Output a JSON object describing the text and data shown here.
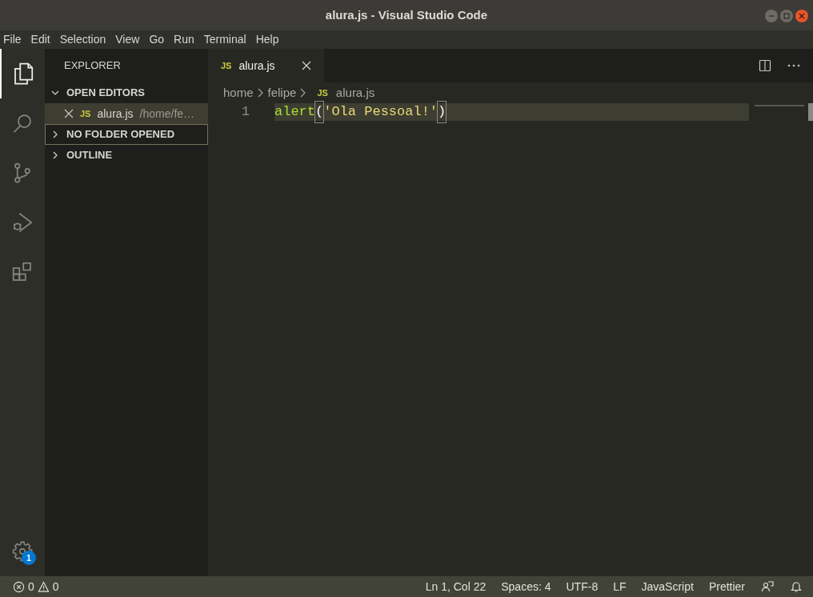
{
  "window": {
    "title": "alura.js - Visual Studio Code"
  },
  "menu": [
    "File",
    "Edit",
    "Selection",
    "View",
    "Go",
    "Run",
    "Terminal",
    "Help"
  ],
  "activity_bar": [
    {
      "kind": "files",
      "selected": true
    },
    {
      "kind": "search",
      "selected": false
    },
    {
      "kind": "scm",
      "selected": false
    },
    {
      "kind": "debug",
      "selected": false
    },
    {
      "kind": "extensions",
      "selected": false
    }
  ],
  "settings_badge": "1",
  "sidebar": {
    "title": "EXPLORER",
    "sections": [
      {
        "title": "OPEN EDITORS",
        "expanded": true,
        "focused": false,
        "items": [
          {
            "icon": "JS",
            "name": "alura.js",
            "path": "/home/fe…",
            "selected": true
          }
        ]
      },
      {
        "title": "NO FOLDER OPENED",
        "expanded": false,
        "focused": true
      },
      {
        "title": "OUTLINE",
        "expanded": false,
        "focused": false
      }
    ]
  },
  "tabs": [
    {
      "icon": "JS",
      "label": "alura.js",
      "selected": true
    }
  ],
  "breadcrumbs": [
    {
      "label": "home"
    },
    {
      "label": "felipe"
    },
    {
      "icon": "JS",
      "label": "alura.js"
    }
  ],
  "code_lines": [
    {
      "number": "1",
      "current": true,
      "tokens": [
        {
          "text": "alert",
          "kind": "function",
          "matched": false
        },
        {
          "text": "(",
          "kind": "punct",
          "matched": true
        },
        {
          "text": "'Ola Pessoal!'",
          "kind": "string",
          "matched": false
        },
        {
          "text": ")",
          "kind": "punct",
          "matched": true
        }
      ]
    }
  ],
  "status_bar": {
    "errors": "0",
    "warnings": "0",
    "items": [
      "Ln 1, Col 22",
      "Spaces: 4",
      "UTF-8",
      "LF",
      "JavaScript",
      "Prettier"
    ]
  }
}
